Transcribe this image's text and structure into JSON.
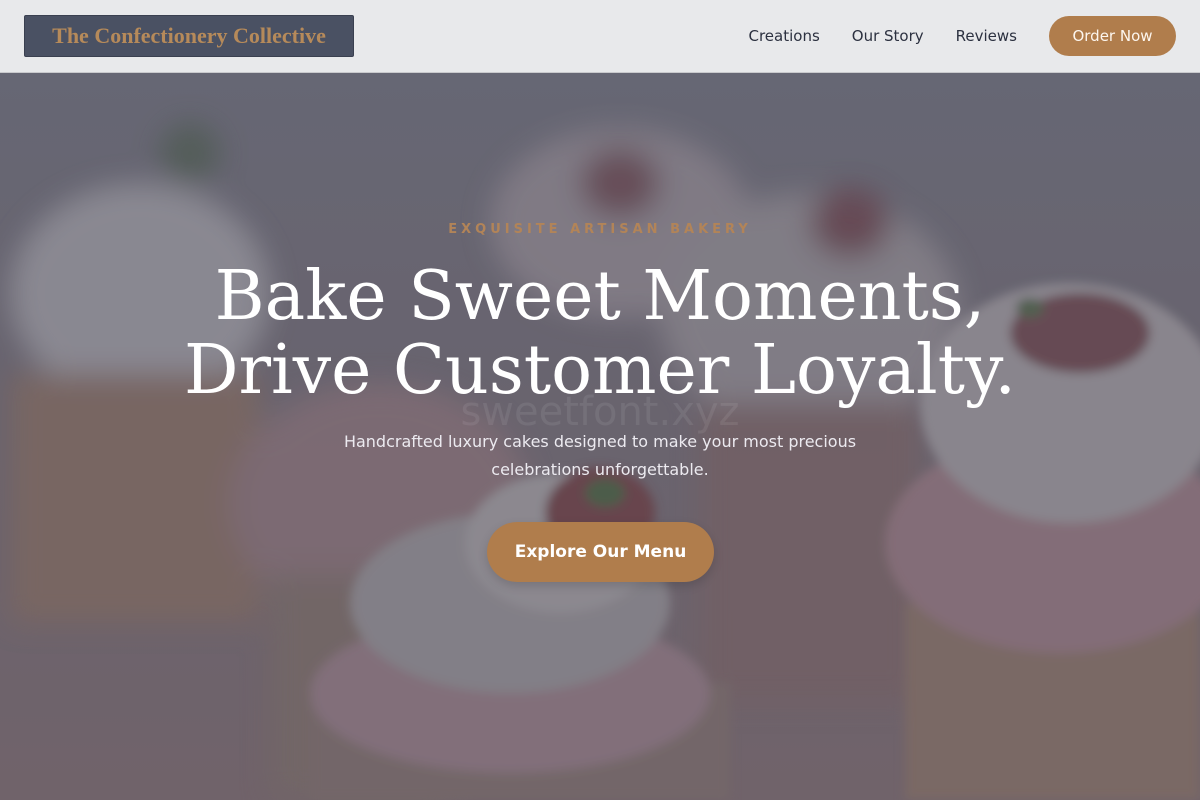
{
  "header": {
    "logo_text": "The Confectionery Collective",
    "nav": [
      {
        "label": "Creations"
      },
      {
        "label": "Our Story"
      },
      {
        "label": "Reviews"
      }
    ],
    "order_button": "Order Now"
  },
  "hero": {
    "eyebrow": "EXQUISITE ARTISAN BAKERY",
    "headline_line1": "Bake Sweet Moments,",
    "headline_line2": "Drive Customer Loyalty.",
    "subline": "Handcrafted luxury cakes designed to make your most precious celebrations unforgettable.",
    "cta": "Explore Our Menu",
    "watermark": "sweetfont.xyz"
  },
  "colors": {
    "accent": "#b07d4c",
    "header_bg": "#e8e9eb",
    "logo_bg": "#4a5163",
    "logo_text": "#b68a5a"
  }
}
